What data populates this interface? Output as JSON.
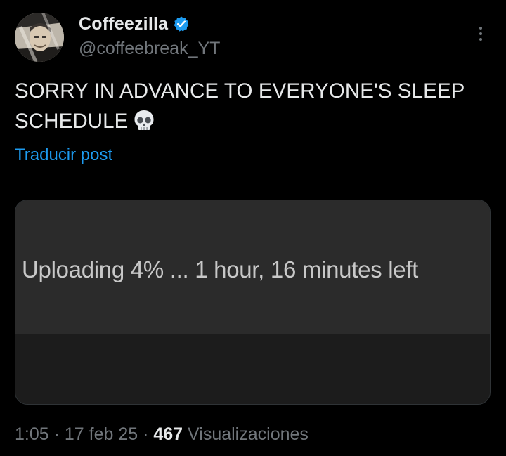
{
  "author": {
    "display_name": "Coffeezilla",
    "handle": "@coffeebreak_YT",
    "verified": true
  },
  "post": {
    "text_line1": "SORRY IN ADVANCE TO EVERYONE'S SLEEP",
    "text_line2": "SCHEDULE",
    "emoji": "skull-icon",
    "translate_label": "Traducir post"
  },
  "media": {
    "upload_status": "Uploading 4% ... 1 hour, 16 minutes left",
    "upload_progress_percent": 4
  },
  "meta": {
    "time": "1:05",
    "separator1": " · ",
    "date": "17 feb 25",
    "separator2": " · ",
    "views_count": "467",
    "views_label": " Visualizaciones"
  },
  "colors": {
    "background": "#000000",
    "primary_text": "#e7e9ea",
    "secondary_text": "#71767b",
    "link": "#1d9bf0",
    "verified_badge": "#1d9bf0"
  }
}
